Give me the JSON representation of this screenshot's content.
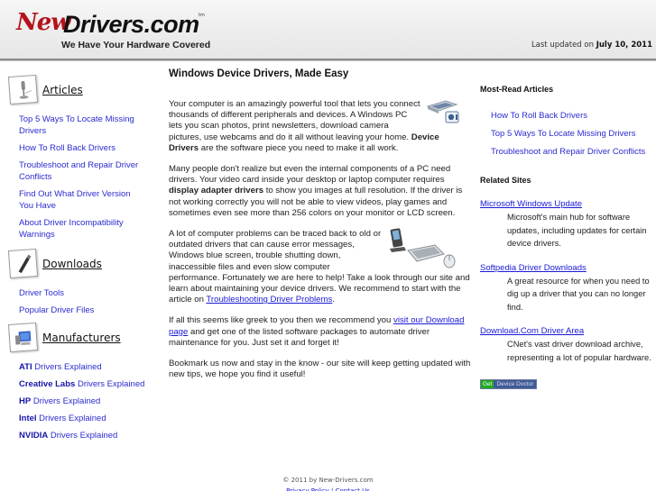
{
  "header": {
    "logo_new": "New",
    "logo_drivers": "Drivers.com",
    "logo_tm": "tm",
    "tagline": "We Have Your Hardware Covered",
    "last_updated_label": "Last updated on",
    "last_updated_date": "July 10, 2011"
  },
  "sidebar": {
    "articles": {
      "title": "Articles",
      "icon": "microphone-icon",
      "items": [
        "Top 5 Ways To Locate Missing Drivers",
        "How To Roll Back Drivers",
        "Troubleshoot and Repair Driver Conflicts",
        "Find Out What Driver Version You Have",
        "About Driver Incompatibility Warnings"
      ]
    },
    "downloads": {
      "title": "Downloads",
      "icon": "usb-drive-icon",
      "items": [
        "Driver Tools",
        "Popular Driver Files"
      ]
    },
    "manufacturers": {
      "title": "Manufacturers",
      "icon": "computer-icon",
      "suffix": "Drivers Explained",
      "items": [
        {
          "brand": "ATI"
        },
        {
          "brand": "Creative Labs"
        },
        {
          "brand": "HP"
        },
        {
          "brand": "Intel"
        },
        {
          "brand": "NVIDIA"
        }
      ]
    }
  },
  "main": {
    "title": "Windows Device Drivers, Made Easy",
    "p1_text": "Your computer is an amazingly powerful tool that lets you connect thousands of different peripherals and devices. A Windows PC lets you scan photos, print newsletters, download camera pictures, use webcams and do it all without leaving your home. ",
    "p1_bold": "Device Drivers",
    "p1_end": " are the software piece you need to make it all work.",
    "p2_start": "Many people don't realize but even the internal components of a PC need drivers. Your video card inside your desktop or laptop computer requires ",
    "p2_bold": "display adapter drivers",
    "p2_end": " to show you images at full resolution. If the driver is not working correctly you will not be able to view videos, play games and sometimes even see more than 256 colors on your monitor or LCD screen.",
    "p3_text": "A lot of computer problems can be traced back to old or outdated drivers that can cause error messages, Windows blue screen, trouble shutting down, inaccessible files and even slow computer performance. Fortunately we are here to help! Take a look through our site and learn about maintaining your device drivers. We recommend to start with the article on ",
    "p3_link": "Troubleshooting Driver Problems",
    "p3_end": ".",
    "p4_text": "If all this seems like greek to you then we recommend you ",
    "p4_link": "visit our Download page",
    "p4_end": " and get one of the listed software packages to automate driver maintenance for you. Just set it and forget it!",
    "p5_text": "Bookmark us now and stay in the know - our site will keep getting updated with new tips, we hope you find it useful!"
  },
  "right": {
    "most_read_title": "Most-Read Articles",
    "most_read": [
      "How To Roll Back Drivers",
      "Top 5 Ways To Locate Missing Drivers",
      "Troubleshoot and Repair Driver Conflicts"
    ],
    "related_title": "Related Sites",
    "related": [
      {
        "name": "Microsoft Windows Update",
        "desc": "Microsoft's main hub for software updates, including updates for certain device drivers."
      },
      {
        "name": "Softpedia Driver Downloads",
        "desc": "A great resource for when you need to dig up a driver that you can no longer find."
      },
      {
        "name": "Download.Com Driver Area",
        "desc": "CNet's vast driver download archive, representing a lot of popular hardware."
      }
    ],
    "badge_get": "Get",
    "badge_label": "Device Doctor"
  },
  "footer": {
    "copyright": "© 2011 by New-Drivers.com",
    "links": "Privacy Policy | Contact Us"
  }
}
